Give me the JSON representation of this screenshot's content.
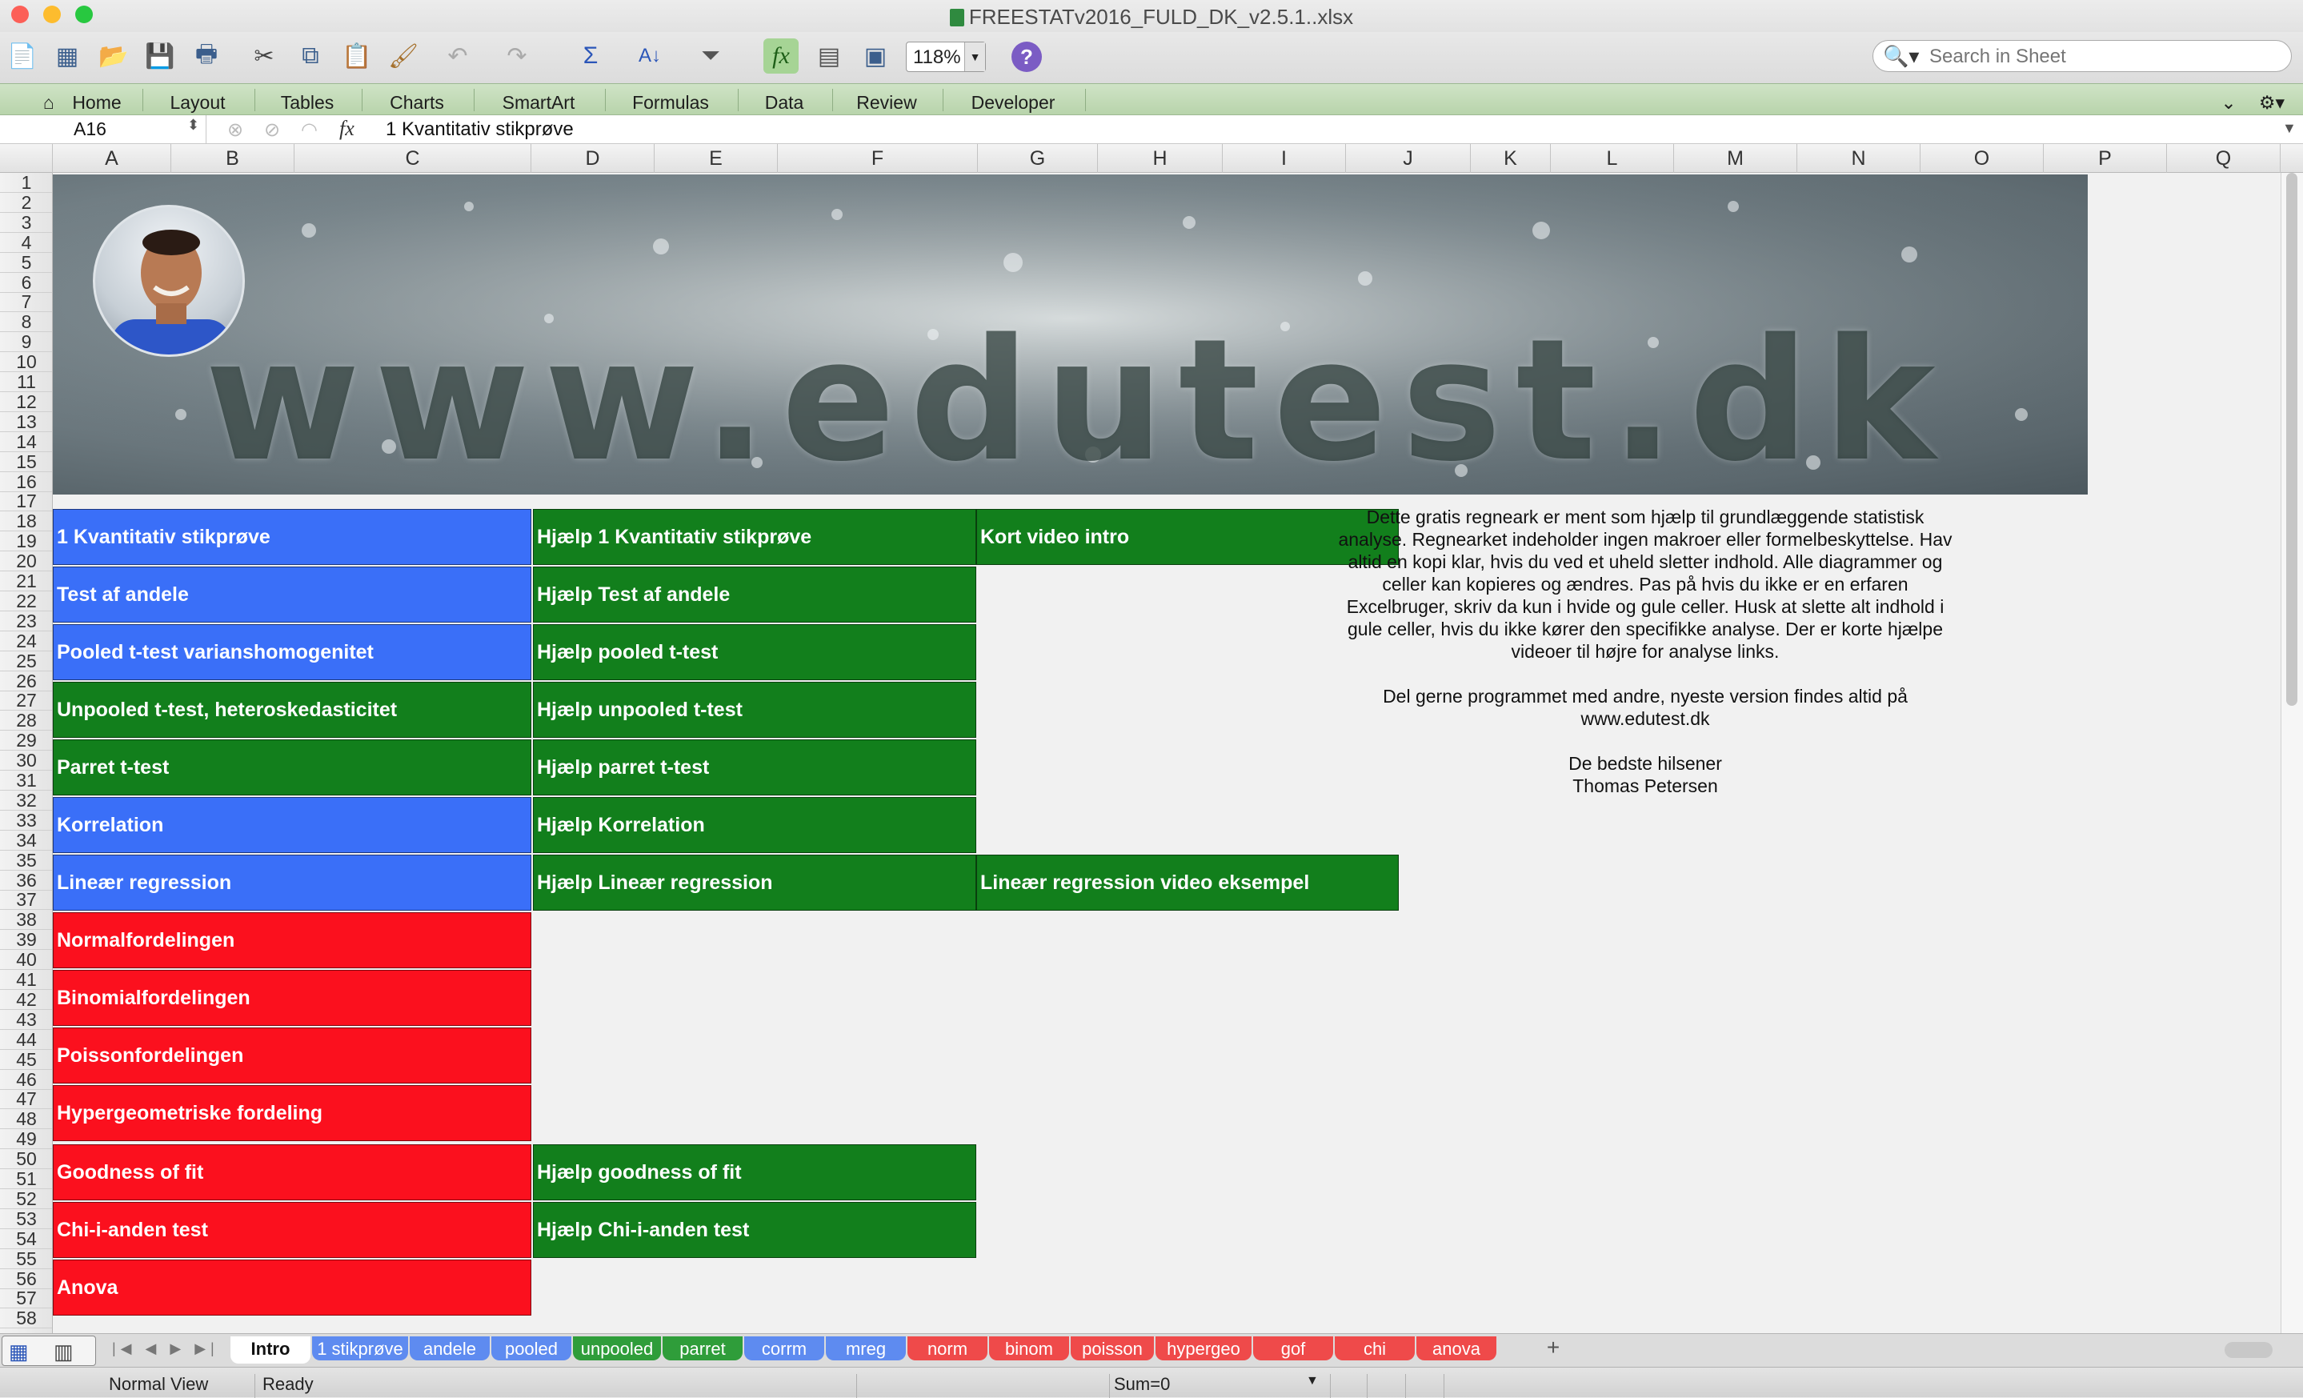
{
  "window": {
    "title": "FREESTATv2016_FULD_DK_v2.5.1..xlsx"
  },
  "toolbar": {
    "zoom": "118%",
    "search_placeholder": "Search in Sheet"
  },
  "ribbon_tabs": [
    "Home",
    "Layout",
    "Tables",
    "Charts",
    "SmartArt",
    "Formulas",
    "Data",
    "Review",
    "Developer"
  ],
  "formula_bar": {
    "name_box": "A16",
    "content": "1 Kvantitativ stikprøve"
  },
  "columns": [
    "A",
    "B",
    "C",
    "D",
    "E",
    "F",
    "G",
    "H",
    "I",
    "J",
    "K",
    "L",
    "M",
    "N",
    "O",
    "P",
    "Q"
  ],
  "banner": {
    "text": "www.edutest.dk"
  },
  "links": {
    "analyses": [
      {
        "label": "1 Kvantitativ stikprøve",
        "color": "#3a6ff8"
      },
      {
        "label": "Test af andele",
        "color": "#3a6ff8"
      },
      {
        "label": "Pooled t-test varianshomogenitet",
        "color": "#3a6ff8"
      },
      {
        "label": "Unpooled t-test, heteroskedasticitet",
        "color": "#127f1c"
      },
      {
        "label": "Parret t-test",
        "color": "#127f1c"
      },
      {
        "label": "Korrelation",
        "color": "#3a6ff8"
      },
      {
        "label": "Lineær regression",
        "color": "#3a6ff8"
      },
      {
        "label": "Normalfordelingen",
        "color": "#fb101e"
      },
      {
        "label": "Binomialfordelingen",
        "color": "#fb101e"
      },
      {
        "label": "Poissonfordelingen",
        "color": "#fb101e"
      },
      {
        "label": "Hypergeometriske fordeling",
        "color": "#fb101e"
      },
      {
        "label": "Goodness of fit",
        "color": "#fb101e"
      },
      {
        "label": "Chi-i-anden test",
        "color": "#fb101e"
      },
      {
        "label": "Anova",
        "color": "#fb101e"
      }
    ],
    "help": [
      "Hjælp 1 Kvantitativ stikprøve",
      "Hjælp Test af andele",
      "Hjælp pooled t-test",
      "Hjælp unpooled t-test",
      "Hjælp parret t-test",
      "Hjælp Korrelation",
      "Hjælp Lineær regression",
      "Hjælp goodness of fit",
      "Hjælp Chi-i-anden test"
    ],
    "videos": [
      "Kort video intro",
      "Lineær regression video eksempel"
    ]
  },
  "intro_text": {
    "paragraph1": "Dette gratis regneark er ment som hjælp til grundlæggende statistisk analyse. Regnearket indeholder ingen makroer eller formelbeskyttelse. Hav altid en kopi klar, hvis du ved et uheld sletter indhold.  Alle diagrammer og celler kan kopieres og ændres. Pas på hvis du ikke er en erfaren Excelbruger, skriv da kun i hvide og gule celler. Husk at slette alt indhold i gule celler, hvis du ikke kører den specifikke analyse. Der er korte hjælpe videoer til højre for analyse links.",
    "paragraph2": "Del gerne programmet med andre, nyeste version findes altid på www.edutest.dk",
    "greeting": "De bedste hilsener",
    "author": "Thomas Petersen"
  },
  "sheet_tabs": [
    {
      "label": "Intro",
      "color": "#ffffff"
    },
    {
      "label": "1 stikprøve",
      "color": "#5e8bf0"
    },
    {
      "label": "andele",
      "color": "#5e8bf0"
    },
    {
      "label": "pooled",
      "color": "#5e8bf0"
    },
    {
      "label": "unpooled",
      "color": "#2f9d3a"
    },
    {
      "label": "parret",
      "color": "#2f9d3a"
    },
    {
      "label": "corrm",
      "color": "#5e8bf0"
    },
    {
      "label": "mreg",
      "color": "#5e8bf0"
    },
    {
      "label": "norm",
      "color": "#ef4a4a"
    },
    {
      "label": "binom",
      "color": "#ef4a4a"
    },
    {
      "label": "poisson",
      "color": "#ef4a4a"
    },
    {
      "label": "hypergeo",
      "color": "#ef4a4a"
    },
    {
      "label": "gof",
      "color": "#ef4a4a"
    },
    {
      "label": "chi",
      "color": "#ef4a4a"
    },
    {
      "label": "anova",
      "color": "#ef4a4a"
    }
  ],
  "status": {
    "view": "Normal View",
    "state": "Ready",
    "sum": "Sum=0"
  }
}
